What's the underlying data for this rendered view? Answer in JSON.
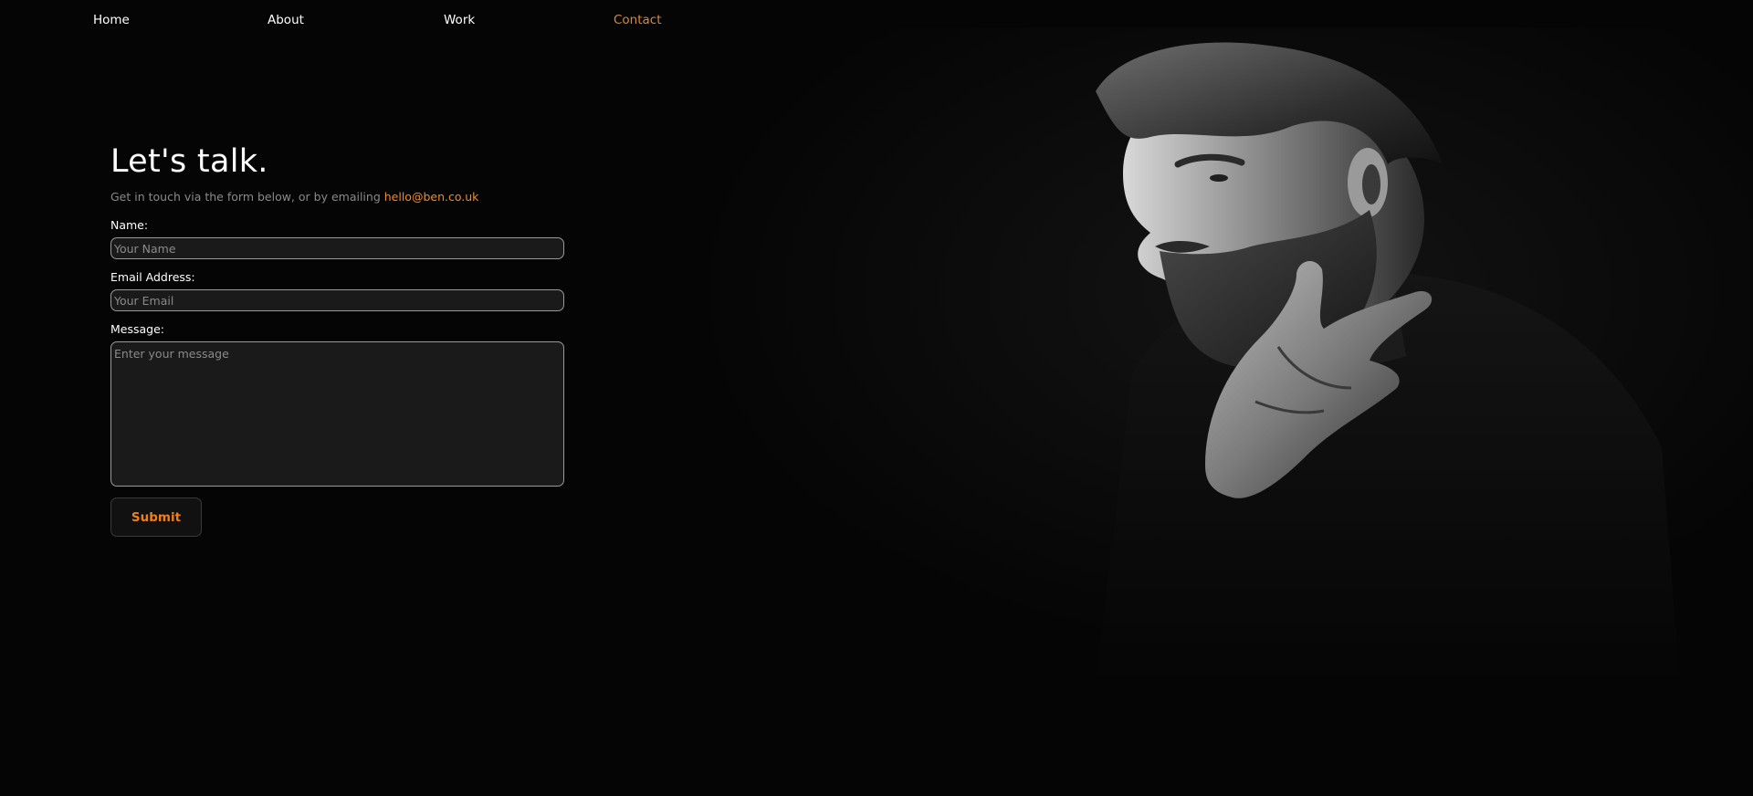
{
  "nav": {
    "items": [
      {
        "label": "Home",
        "active": false
      },
      {
        "label": "About",
        "active": false
      },
      {
        "label": "Work",
        "active": false
      },
      {
        "label": "Contact",
        "active": true
      }
    ]
  },
  "contact": {
    "title": "Let's talk.",
    "intro_text": "Get in touch via the form below, or by emailing ",
    "email_link": "hello@ben.co.uk",
    "fields": {
      "name": {
        "label": "Name:",
        "placeholder": "Your Name",
        "value": ""
      },
      "email": {
        "label": "Email Address:",
        "placeholder": "Your Email",
        "value": ""
      },
      "message": {
        "label": "Message:",
        "placeholder": "Enter your message",
        "value": ""
      }
    },
    "submit_label": "Submit"
  },
  "colors": {
    "background": "#050505",
    "accent": "#ef7f1a",
    "active_nav": "#d98a37",
    "field_bg": "#1a1a1a"
  },
  "hero_image": {
    "icon": "portrait-photo-icon"
  }
}
